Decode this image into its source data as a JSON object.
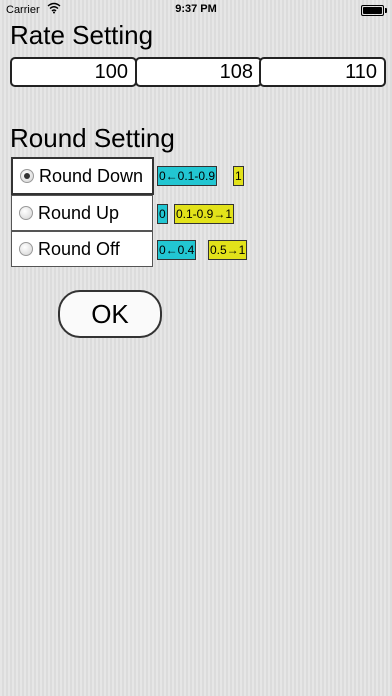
{
  "status_bar": {
    "carrier": "Carrier",
    "time": "9:37 PM"
  },
  "rate": {
    "title": "Rate Setting",
    "values": [
      "100",
      "108",
      "110"
    ]
  },
  "round": {
    "title": "Round Setting",
    "options": [
      {
        "label": "Round Down",
        "selected": true,
        "tags": [
          {
            "text": "0←0.1-0.9",
            "color": "#22c6d2"
          },
          {
            "text": "1",
            "color": "#e2e21a"
          }
        ]
      },
      {
        "label": "Round Up",
        "selected": false,
        "tags": [
          {
            "text": "0",
            "color": "#22c6d2"
          },
          {
            "text": "0.1-0.9→1",
            "color": "#e2e21a"
          }
        ]
      },
      {
        "label": "Round Off",
        "selected": false,
        "tags": [
          {
            "text": "0←0.4",
            "color": "#22c6d2"
          },
          {
            "text": "0.5→1",
            "color": "#e2e21a"
          }
        ]
      }
    ]
  },
  "ok_label": "OK"
}
